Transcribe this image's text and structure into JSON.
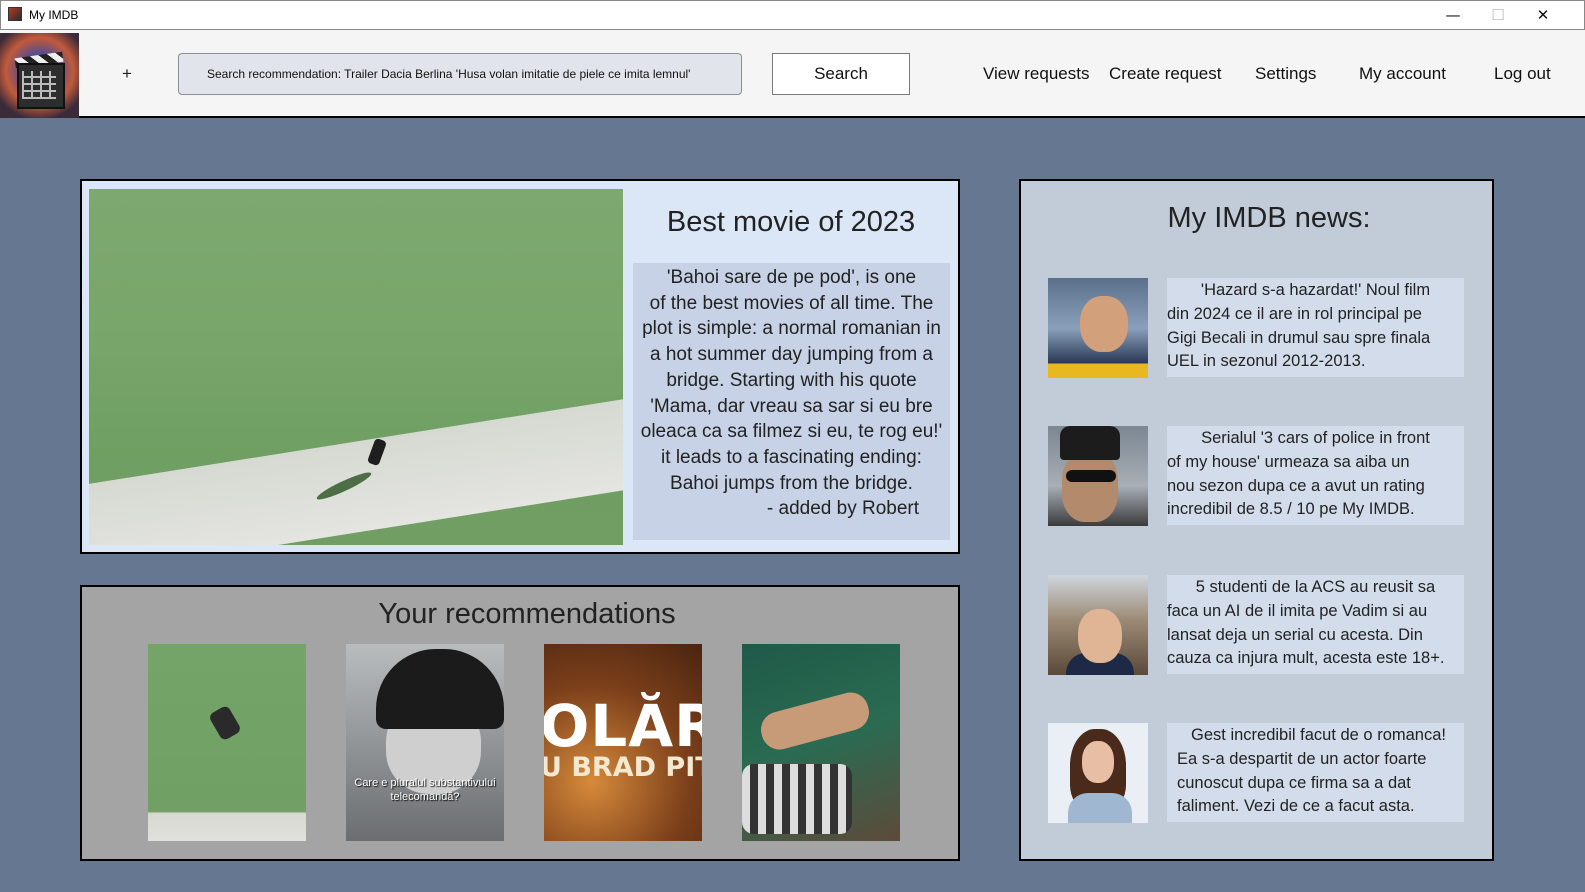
{
  "window": {
    "title": "My IMDB",
    "controls": {
      "minimize": "—",
      "maximize": "☐",
      "close": "✕"
    }
  },
  "toolbar": {
    "add_label": "+",
    "search_value": "Search recommendation: Trailer Dacia Berlina 'Husa volan imitatie de piele ce imita lemnul'",
    "search_button": "Search",
    "nav": {
      "view_requests": "View requests",
      "create_request": "Create request",
      "settings": "Settings",
      "my_account": "My account",
      "log_out": "Log out"
    }
  },
  "featured": {
    "title": "Best movie of 2023",
    "description_lines": [
      "'Bahoi sare de pe pod', is one",
      "of the best movies of all time. The",
      "plot is simple: a normal romanian in",
      "a hot summer day jumping from a",
      "bridge. Starting with his quote",
      "'Mama, dar vreau sa sar si eu bre",
      "oleaca ca sa filmez si eu, te rog eu!'",
      "it leads to a fascinating ending:",
      "Bahoi jumps from the bridge."
    ],
    "author": "- added by Robert"
  },
  "recommendations": {
    "title": "Your recommendations",
    "items": [
      {
        "caption": ""
      },
      {
        "caption": "Care e pluralul substantivului telecomandă?"
      },
      {
        "caption": "OLĂRIT",
        "subcaption": "U BRAD PIT"
      },
      {
        "caption": ""
      }
    ]
  },
  "news": {
    "title": "My IMDB news:",
    "items": [
      {
        "lines": [
          "'Hazard s-a hazardat!' Noul film",
          "din 2024 ce il are in rol principal pe",
          "Gigi Becali in drumul sau spre finala",
          "UEL in sezonul 2012-2013."
        ]
      },
      {
        "lines": [
          "Serialul '3 cars of police in front",
          "of my house' urmeaza sa aiba un",
          "nou sezon dupa ce a avut un rating",
          "incredibil de 8.5 / 10 pe My IMDB."
        ]
      },
      {
        "lines": [
          "5 studenti de la ACS au reusit sa",
          "faca un AI de il imita pe Vadim si au",
          "lansat deja un serial cu acesta. Din",
          "cauza ca injura mult, acesta este 18+."
        ]
      },
      {
        "lines": [
          "Gest incredibil facut de o romanca!",
          "Ea s-a despartit de un actor foarte",
          "cunoscut dupa ce firma sa a dat",
          "faliment. Vezi de ce a facut asta."
        ]
      }
    ]
  },
  "colors": {
    "background": "#667891",
    "featured_panel": "#dbe6f7",
    "featured_text_box": "#c7d2e6",
    "recommendations_panel": "#a4a4a4",
    "news_panel": "#c2ccd9",
    "news_text_box": "#d3dcea"
  }
}
